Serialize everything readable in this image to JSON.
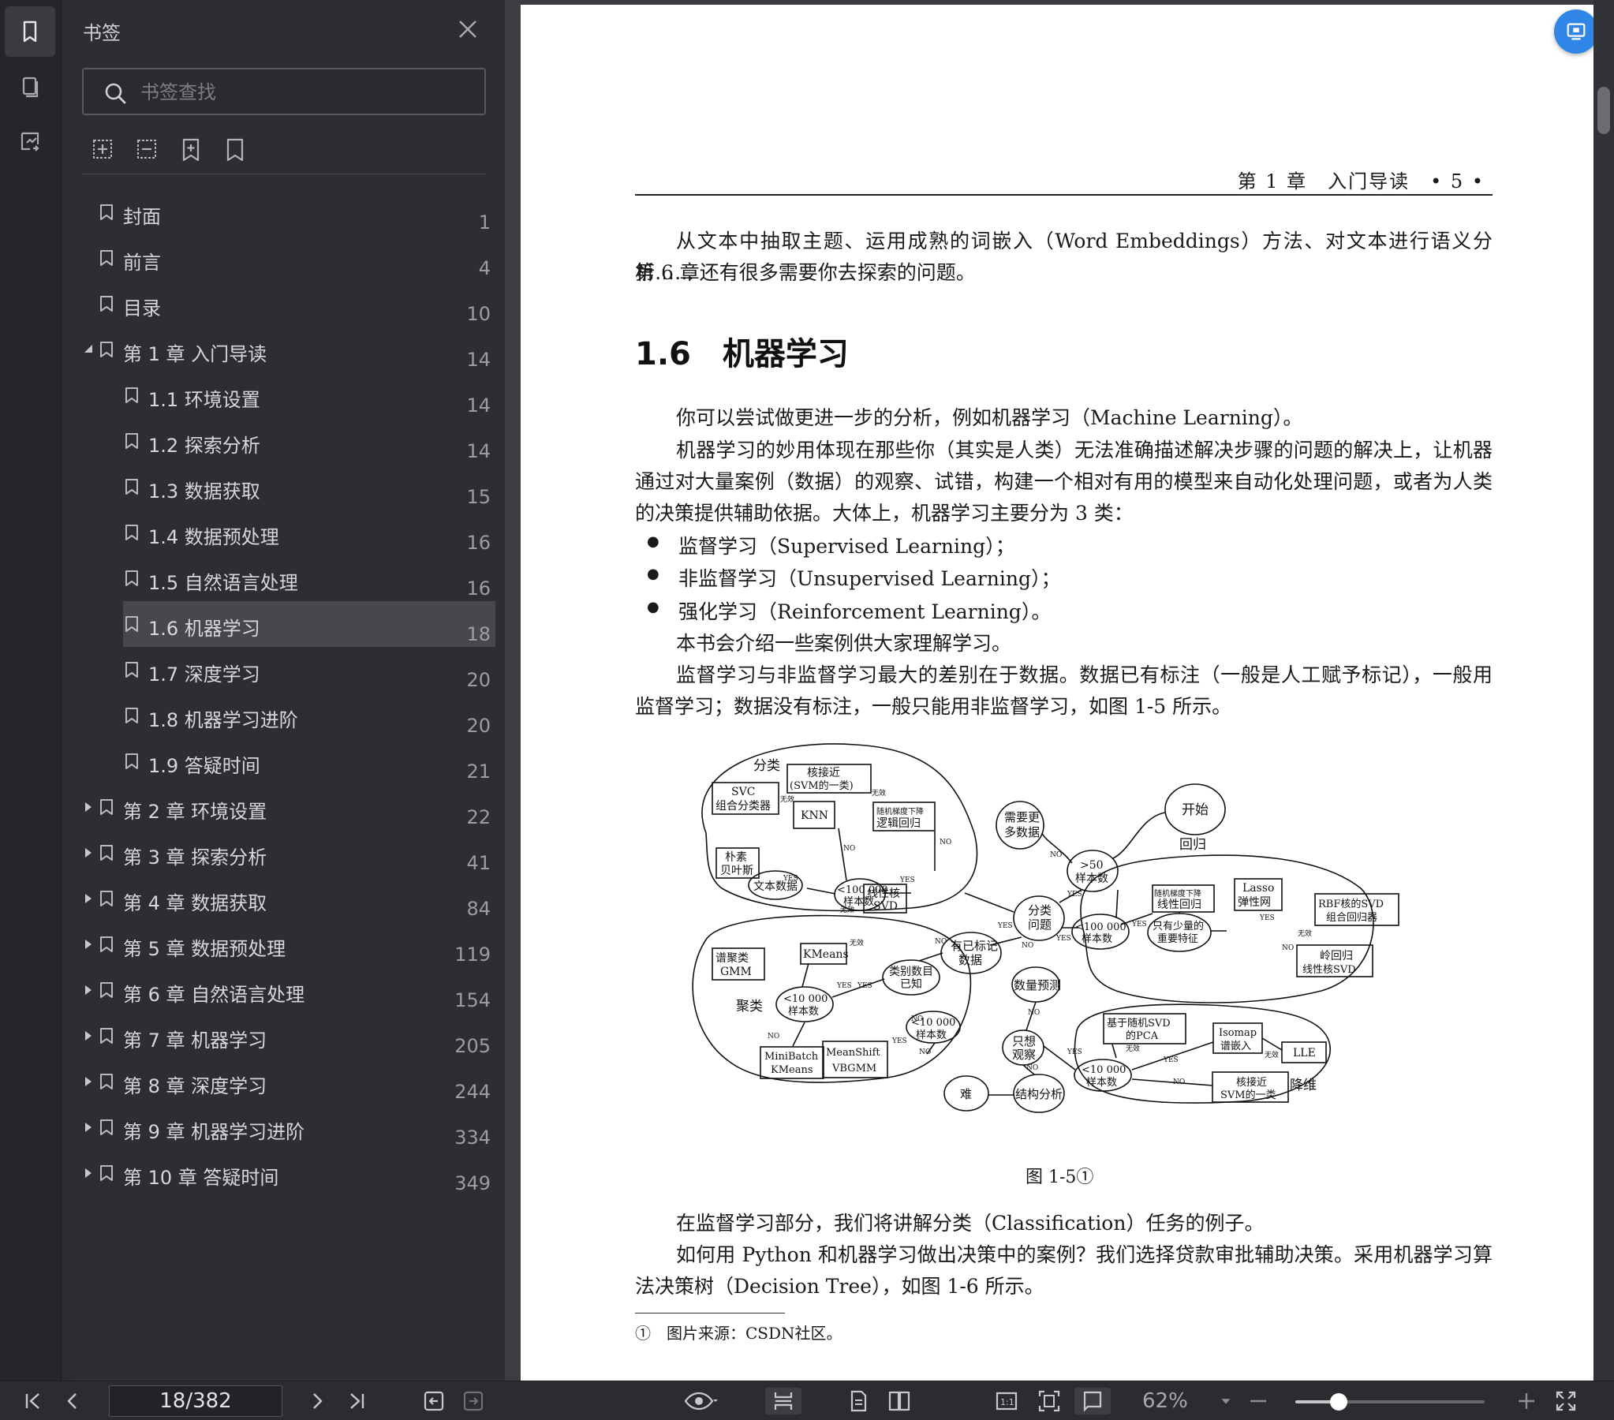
{
  "sidebar": {
    "title": "书签",
    "search_placeholder": "书签查找",
    "items": [
      {
        "label": "封面",
        "page": "1",
        "level": 0,
        "arrow": ""
      },
      {
        "label": "前言",
        "page": "4",
        "level": 0,
        "arrow": ""
      },
      {
        "label": "目录",
        "page": "10",
        "level": 0,
        "arrow": ""
      },
      {
        "label": "第 1 章 入门导读",
        "page": "14",
        "level": 0,
        "arrow": "down"
      },
      {
        "label": "1.1 环境设置",
        "page": "14",
        "level": 1,
        "arrow": ""
      },
      {
        "label": "1.2 探索分析",
        "page": "14",
        "level": 1,
        "arrow": ""
      },
      {
        "label": "1.3 数据获取",
        "page": "15",
        "level": 1,
        "arrow": ""
      },
      {
        "label": "1.4 数据预处理",
        "page": "16",
        "level": 1,
        "arrow": ""
      },
      {
        "label": "1.5 自然语言处理",
        "page": "16",
        "level": 1,
        "arrow": ""
      },
      {
        "label": "1.6 机器学习",
        "page": "18",
        "level": 1,
        "arrow": "",
        "selected": true
      },
      {
        "label": "1.7 深度学习",
        "page": "20",
        "level": 1,
        "arrow": ""
      },
      {
        "label": "1.8 机器学习进阶",
        "page": "20",
        "level": 1,
        "arrow": ""
      },
      {
        "label": "1.9 答疑时间",
        "page": "21",
        "level": 1,
        "arrow": ""
      },
      {
        "label": "第 2 章 环境设置",
        "page": "22",
        "level": 0,
        "arrow": "right"
      },
      {
        "label": "第 3 章 探索分析",
        "page": "41",
        "level": 0,
        "arrow": "right"
      },
      {
        "label": "第 4 章 数据获取",
        "page": "84",
        "level": 0,
        "arrow": "right"
      },
      {
        "label": "第 5 章 数据预处理",
        "page": "119",
        "level": 0,
        "arrow": "right"
      },
      {
        "label": "第 6 章 自然语言处理",
        "page": "154",
        "level": 0,
        "arrow": "right"
      },
      {
        "label": "第 7 章 机器学习",
        "page": "205",
        "level": 0,
        "arrow": "right"
      },
      {
        "label": "第 8 章 深度学习",
        "page": "244",
        "level": 0,
        "arrow": "right"
      },
      {
        "label": "第 9 章 机器学习进阶",
        "page": "334",
        "level": 0,
        "arrow": "right"
      },
      {
        "label": "第 10 章 答疑时间",
        "page": "349",
        "level": 0,
        "arrow": "right"
      }
    ]
  },
  "page": {
    "running_head": "第 1 章　入门导读　• 5 •",
    "intro_line1": "从文本中抽取主题、运用成熟的词嵌入（Word Embeddings）方法、对文本进行语义分析……",
    "intro_line2": "第 6 章还有很多需要你去探索的问题。",
    "section_title": "1.6　机器学习",
    "para1": "你可以尝试做更进一步的分析，例如机器学习（Machine Learning）。",
    "para2": "机器学习的妙用体现在那些你（其实是人类）无法准确描述解决步骤的问题的解决上，让机器通过对大量案例（数据）的观察、试错，构建一个相对有用的模型来自动化处理问题，或者为人类的决策提供辅助依据。大体上，机器学习主要分为 3 类：",
    "bullets": [
      "监督学习（Supervised Learning）；",
      "非监督学习（Unsupervised Learning）；",
      "强化学习（Reinforcement Learning）。"
    ],
    "para3": "本书会介绍一些案例供大家理解学习。",
    "para4": "监督学习与非监督学习最大的差别在于数据。数据已有标注（一般是人工赋予标记），一般用监督学习；数据没有标注，一般只能用非监督学习，如图 1-5 所示。",
    "figure_caption": "图 1-5①",
    "para5": "在监督学习部分，我们将讲解分类（Classification）任务的例子。",
    "para6": "如何用 Python 和机器学习做出决策中的案例？我们选择贷款审批辅助决策。采用机器学习算法决策树（Decision Tree），如图 1-6 所示。",
    "footnote": "①　图片来源：CSDN社区。"
  },
  "diagram": {
    "region_classify": "分类",
    "region_regress": "回归",
    "region_cluster": "聚类",
    "region_reduce": "降维",
    "start": "开始",
    "more_data_1": "需要更",
    "more_data_2": "多数据",
    "gt50_1": ">50",
    "gt50_2": "样本数",
    "classify_q_1": "分类",
    "classify_q_2": "问题",
    "labeled_1": "有已标记",
    "labeled_2": "数据",
    "predict_qty": "数量预测",
    "just_look_1": "只想",
    "just_look_2": "观察",
    "structure": "结构分析",
    "hard": "难",
    "svc_1": "SVC",
    "svc_2": "组合分类器",
    "knn_svm_1": "核接近",
    "knn_svm_2": "(SVM的一类)",
    "knn": "KNN",
    "sgd_1": "随机梯度下降",
    "sgd_2": "逻辑回归",
    "nb_1": "朴素",
    "nb_2": "贝叶斯",
    "text_data": "文本数据",
    "linear_svd_1": "线性核",
    "linear_svd_2": "SVD",
    "lt100k_1": "<100 000",
    "lt100k_2": "样本数",
    "sgd_reg_1": "随机梯度下降",
    "sgd_reg_2": "线性回归",
    "lasso_1": "Lasso",
    "lasso_2": "弹性网",
    "rbf_1": "RBF核的SVD",
    "rbf_2": "组合回归器",
    "few_feat_1": "只有少量的",
    "few_feat_2": "重要特征",
    "ridge_1": "岭回归",
    "ridge_2": "线性核SVD",
    "spectral_1": "谱聚类",
    "spectral_2": "GMM",
    "kmeans": "KMeans",
    "cat_known_1": "类别数目",
    "cat_known_2": "已知",
    "lt10k_1": "<10 000",
    "lt10k_2": "样本数",
    "minibatch_1": "MiniBatch",
    "minibatch_2": "KMeans",
    "meanshift_1": "MeanShift",
    "meanshift_2": "VBGMM",
    "pca_1": "基于随机SVD",
    "pca_2": "的PCA",
    "isomap_1": "Isomap",
    "isomap_2": "谱嵌入",
    "lle": "LLE",
    "knn_svm2_1": "核接近",
    "knn_svm2_2": "SVM的一类",
    "yes": "YES",
    "no": "NO",
    "fail": "无效"
  },
  "bottombar": {
    "page_indicator": "18/382",
    "zoom": "62%",
    "zoom_fraction": 0.23
  }
}
